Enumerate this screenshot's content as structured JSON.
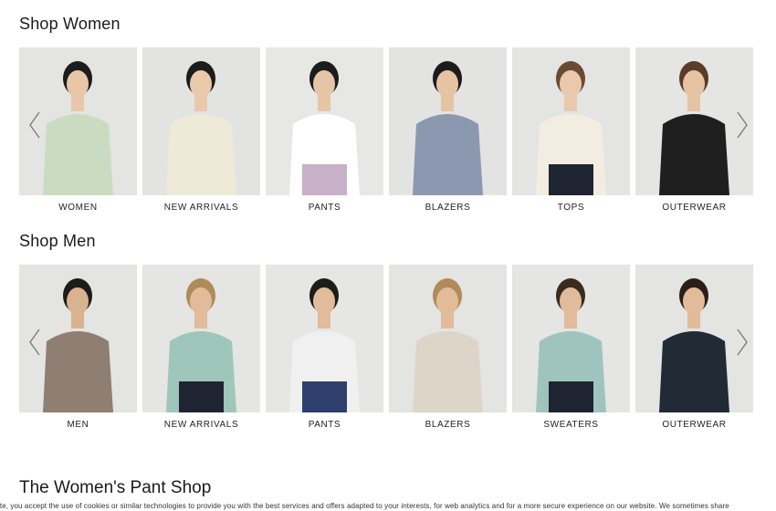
{
  "women": {
    "title": "Shop Women",
    "items": [
      {
        "label": "WOMEN",
        "bg": "#e4e4e2",
        "top": "#c9dcc2",
        "bottom": "#c9dcc2",
        "skin": "#e8c6a8",
        "hair": "#1c1c1c"
      },
      {
        "label": "NEW ARRIVALS",
        "bg": "#e3e3e1",
        "top": "#efe9d8",
        "bottom": "#efe9d8",
        "skin": "#e9c8ab",
        "hair": "#1c1c1c"
      },
      {
        "label": "PANTS",
        "bg": "#e7e7e5",
        "top": "#ffffff",
        "bottom": "#c8b0c8",
        "skin": "#e6c5a7",
        "hair": "#1c1c1c"
      },
      {
        "label": "BLAZERS",
        "bg": "#e3e3e1",
        "top": "#8b98b0",
        "bottom": "#8b98b0",
        "skin": "#e6c3a3",
        "hair": "#1c1c1c"
      },
      {
        "label": "TOPS",
        "bg": "#e4e4e2",
        "top": "#f3ede1",
        "bottom": "#1f2433",
        "skin": "#e9c8ab",
        "hair": "#6b4a32"
      },
      {
        "label": "OUTERWEAR",
        "bg": "#e5e5e3",
        "top": "#1f1f1f",
        "bottom": "#1f1f1f",
        "skin": "#e6c3a3",
        "hair": "#5a3d28"
      }
    ]
  },
  "men": {
    "title": "Shop Men",
    "items": [
      {
        "label": "MEN",
        "bg": "#e4e4e2",
        "top": "#8e7f72",
        "bottom": "#8e7f72",
        "skin": "#d9b28f",
        "hair": "#1c1c1c"
      },
      {
        "label": "NEW ARRIVALS",
        "bg": "#e5e5e3",
        "top": "#9fc6bb",
        "bottom": "#1f2433",
        "skin": "#e2bb9a",
        "hair": "#b08b5a"
      },
      {
        "label": "PANTS",
        "bg": "#e6e6e4",
        "top": "#f0f0f0",
        "bottom": "#2e3f6e",
        "skin": "#e2bb9a",
        "hair": "#1c1c1c"
      },
      {
        "label": "BLAZERS",
        "bg": "#e4e4e2",
        "top": "#ddd5c8",
        "bottom": "#ddd5c8",
        "skin": "#e2bb9a",
        "hair": "#b08b5a"
      },
      {
        "label": "SWEATERS",
        "bg": "#e5e5e3",
        "top": "#9fc4bd",
        "bottom": "#1f2433",
        "skin": "#e2bb9a",
        "hair": "#3a2a1f"
      },
      {
        "label": "OUTERWEAR",
        "bg": "#e4e4e2",
        "top": "#222a36",
        "bottom": "#222a36",
        "skin": "#e2bb9a",
        "hair": "#2a1f18"
      }
    ]
  },
  "pant_shop": {
    "title": "The Women's Pant Shop"
  },
  "cookie": {
    "text": "ite, you accept the use of cookies or similar technologies to provide you with the best services and offers adapted to your interests, for web analytics and for a more secure experience on our website. We sometimes share"
  },
  "icons": {
    "prev": "chevron-left-icon",
    "next": "chevron-right-icon"
  }
}
